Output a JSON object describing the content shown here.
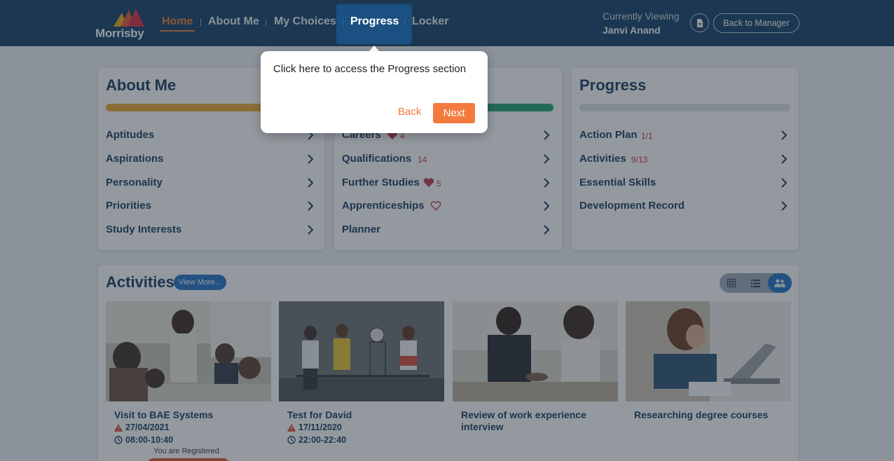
{
  "nav": {
    "logo_text": "Morrisby",
    "items": [
      {
        "label": "Home"
      },
      {
        "label": "About Me"
      },
      {
        "label": "My Choices"
      },
      {
        "label": "Progress"
      },
      {
        "label": "Locker"
      }
    ],
    "separator": "|",
    "viewing_label": "Currently Viewing",
    "viewing_name": "Janvi Anand",
    "back_to_manager": "Back to Manager",
    "colors": {
      "bg": "#0e3a63",
      "active": "#f07a3c",
      "highlight": "#155fa3"
    }
  },
  "about_me": {
    "title": "About Me",
    "bar_color": "#f0a630",
    "items": [
      {
        "label": "Aptitudes"
      },
      {
        "label": "Aspirations"
      },
      {
        "label": "Personality"
      },
      {
        "label": "Priorities"
      },
      {
        "label": "Study Interests"
      }
    ]
  },
  "my_choices": {
    "bar_color": "#1f9e6e",
    "items": [
      {
        "label": "Careers",
        "meta": "4",
        "heart": "filled"
      },
      {
        "label": "Qualifications",
        "meta": "14"
      },
      {
        "label": "Further Studies",
        "meta": "5",
        "heart": "filled"
      },
      {
        "label": "Apprenticeships",
        "heart": "outline"
      },
      {
        "label": "Planner"
      }
    ]
  },
  "progress": {
    "title": "Progress",
    "items": [
      {
        "label": "Action Plan",
        "meta": "1/1"
      },
      {
        "label": "Activities",
        "meta": "9/13"
      },
      {
        "label": "Essential Skills"
      },
      {
        "label": "Development Record"
      }
    ]
  },
  "activities": {
    "title": "Activities",
    "view_more": "View More...",
    "view_modes": [
      "grid-icon",
      "list-icon",
      "people-icon"
    ],
    "active_view": "people-icon",
    "tiles": [
      {
        "title": "Visit to BAE Systems",
        "date": "27/04/2021",
        "time": "08:00-10:40",
        "status": "You are Registered"
      },
      {
        "title": "Test for David",
        "date": "17/11/2020",
        "time": "22:00-22:40"
      },
      {
        "title": "Review of work experience interview"
      },
      {
        "title": "Researching degree courses"
      }
    ]
  },
  "tooltip": {
    "text": "Click here to access the Progress section",
    "back": "Back",
    "next": "Next"
  }
}
